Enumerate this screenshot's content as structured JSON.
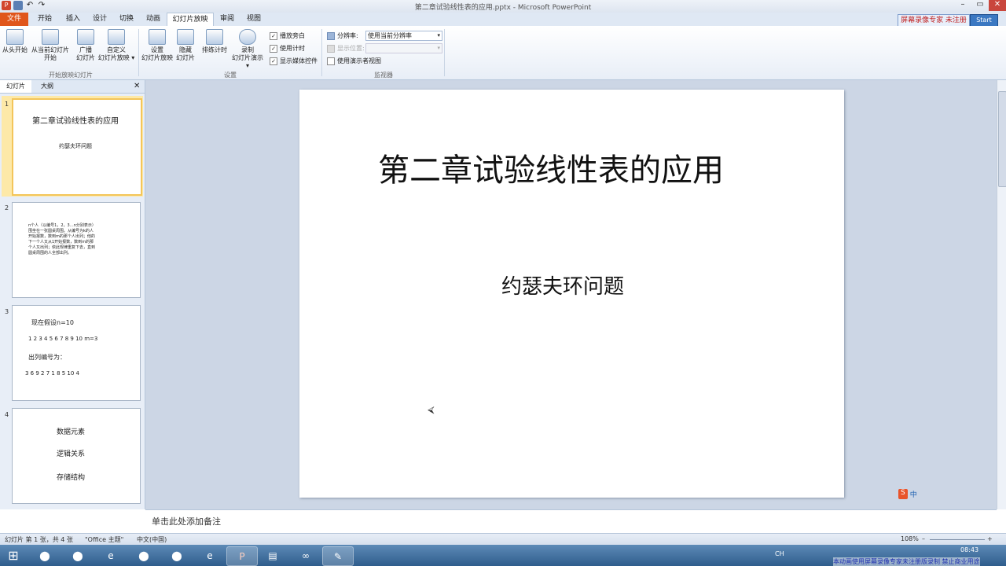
{
  "window": {
    "title": "第二章试验线性表的应用.pptx - Microsoft PowerPoint",
    "min": "–",
    "max": "▭",
    "close": "✕"
  },
  "qat": {
    "app_icon": "P",
    "undo": "↶",
    "redo": "↷"
  },
  "tabs": [
    "文件",
    "开始",
    "插入",
    "设计",
    "切换",
    "动画",
    "幻灯片放映",
    "审阅",
    "视图"
  ],
  "active_tab": "幻灯片放映",
  "ribbon": {
    "group1": {
      "label": "开始放映幻灯片",
      "buttons": [
        {
          "l1": "从头开始",
          "l2": ""
        },
        {
          "l1": "从当前幻灯片",
          "l2": "开始"
        },
        {
          "l1": "广播",
          "l2": "幻灯片"
        },
        {
          "l1": "自定义",
          "l2": "幻灯片放映 ▾"
        }
      ]
    },
    "group2": {
      "label": "设置",
      "buttons": [
        {
          "l1": "设置",
          "l2": "幻灯片放映"
        },
        {
          "l1": "隐藏",
          "l2": "幻灯片"
        },
        {
          "l1": "排练计时",
          "l2": ""
        },
        {
          "l1": "录制",
          "l2": "幻灯片演示 ▾"
        }
      ],
      "checks": [
        {
          "label": "播放旁白",
          "checked": true
        },
        {
          "label": "使用计时",
          "checked": true
        },
        {
          "label": "显示媒体控件",
          "checked": true
        }
      ]
    },
    "group3": {
      "label": "监视器",
      "resolution_label": "分辨率:",
      "resolution_value": "使用当前分辨率",
      "show_on_label": "显示位置:",
      "presenter_view": "使用演示者视图",
      "presenter_checked": false
    }
  },
  "pane_tabs": [
    "幻灯片",
    "大纲"
  ],
  "pane_close": "✕",
  "thumbs": [
    {
      "num": "1",
      "title": "第二章试验线性表的应用",
      "sub": "约瑟夫环问题"
    },
    {
      "num": "2",
      "lines": [
        "n个人（以编号1，2，3…n分别表示）",
        "围坐在一张圆桌周围。从编号为k的人",
        "开始报数，数到m的那个人出列；他的",
        "下一个人又从1开始报数，数到m的那",
        "个人又出列；依此规律重复下去，直到",
        "圆桌周围的人全部出列。"
      ]
    },
    {
      "num": "3",
      "lines": [
        "现在假设n=10",
        "1 2 3 4 5 6 7 8 9 10   m=3",
        "出列编号为：",
        "3 6 9 2 7 1 8 5 10 4"
      ]
    },
    {
      "num": "4",
      "lines": [
        "数据元素",
        "逻辑关系",
        "存储结构"
      ]
    }
  ],
  "slide": {
    "title": "第二章试验线性表的应用",
    "subtitle": "约瑟夫环问题"
  },
  "notes_placeholder": "单击此处添加备注",
  "status": {
    "slide_info": "幻灯片 第 1 张，共 4 张",
    "theme": "\"Office 主题\"",
    "language": "中文(中国)",
    "zoom": "108%",
    "zoom_minus": "–",
    "zoom_plus": "+"
  },
  "taskbar": {
    "start": "⊞",
    "apps": [
      "⬤",
      "⬤",
      "e",
      "⬤",
      "⬤",
      "e",
      "P",
      "▤",
      "∞",
      "✎"
    ],
    "tray_lang": "CH",
    "time": "08:43",
    "watermark": "本动画使用屏幕录像专家未注册版录制  禁止商业用途"
  },
  "overlay": {
    "brand": "屏幕录像专家 未注册",
    "start_label": "Start"
  },
  "ime": {
    "logo": "S",
    "mode": "中"
  },
  "colors": {
    "file_tab": "#e0561b",
    "selection": "#f3c55a",
    "taskbar": "#2f5d8c"
  }
}
